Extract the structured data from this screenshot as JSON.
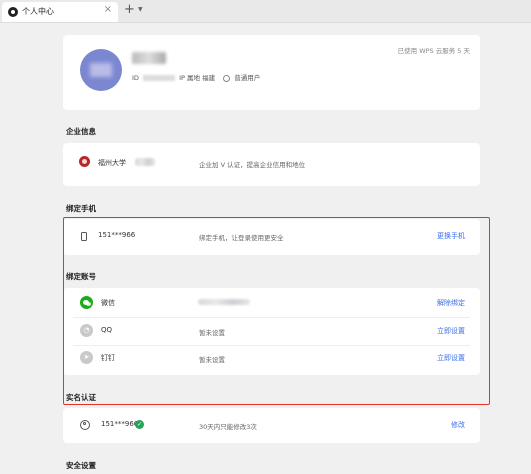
{
  "tab": {
    "title": "个人中心",
    "close": "×",
    "add": "+",
    "dropdown": "⌄"
  },
  "profile": {
    "id_prefix": "ID",
    "ip_label": "IP 属地 福建",
    "user_type": "普通用户",
    "storage_note": "已使用 WPS 云服务 5 天"
  },
  "sections": {
    "enterprise": "企业信息",
    "phone": "绑定手机",
    "accounts": "绑定账号",
    "realname": "实名认证",
    "security": "安全设置"
  },
  "enterprise": {
    "name": "福州大学",
    "note": "企业加 V 认证，提高企业信用和地位"
  },
  "phone": {
    "number": "151***966",
    "note": "绑定手机，让登录使用更安全",
    "action": "更换手机"
  },
  "accounts": [
    {
      "name": "微信",
      "status": "",
      "action": "解除绑定",
      "icon": "wechat-icon"
    },
    {
      "name": "QQ",
      "status": "暂未设置",
      "action": "立即设置",
      "icon": "qq-icon"
    },
    {
      "name": "钉钉",
      "status": "暂未设置",
      "action": "立即设置",
      "icon": "dingtalk-icon"
    }
  ],
  "realname": {
    "number": "151***966",
    "note": "30天内只能修改3次",
    "action": "修改"
  },
  "colors": {
    "link": "#3a6ee8",
    "highlight": "#e0342c",
    "wechat": "#1aad19",
    "avatar": "#7b87d1"
  }
}
